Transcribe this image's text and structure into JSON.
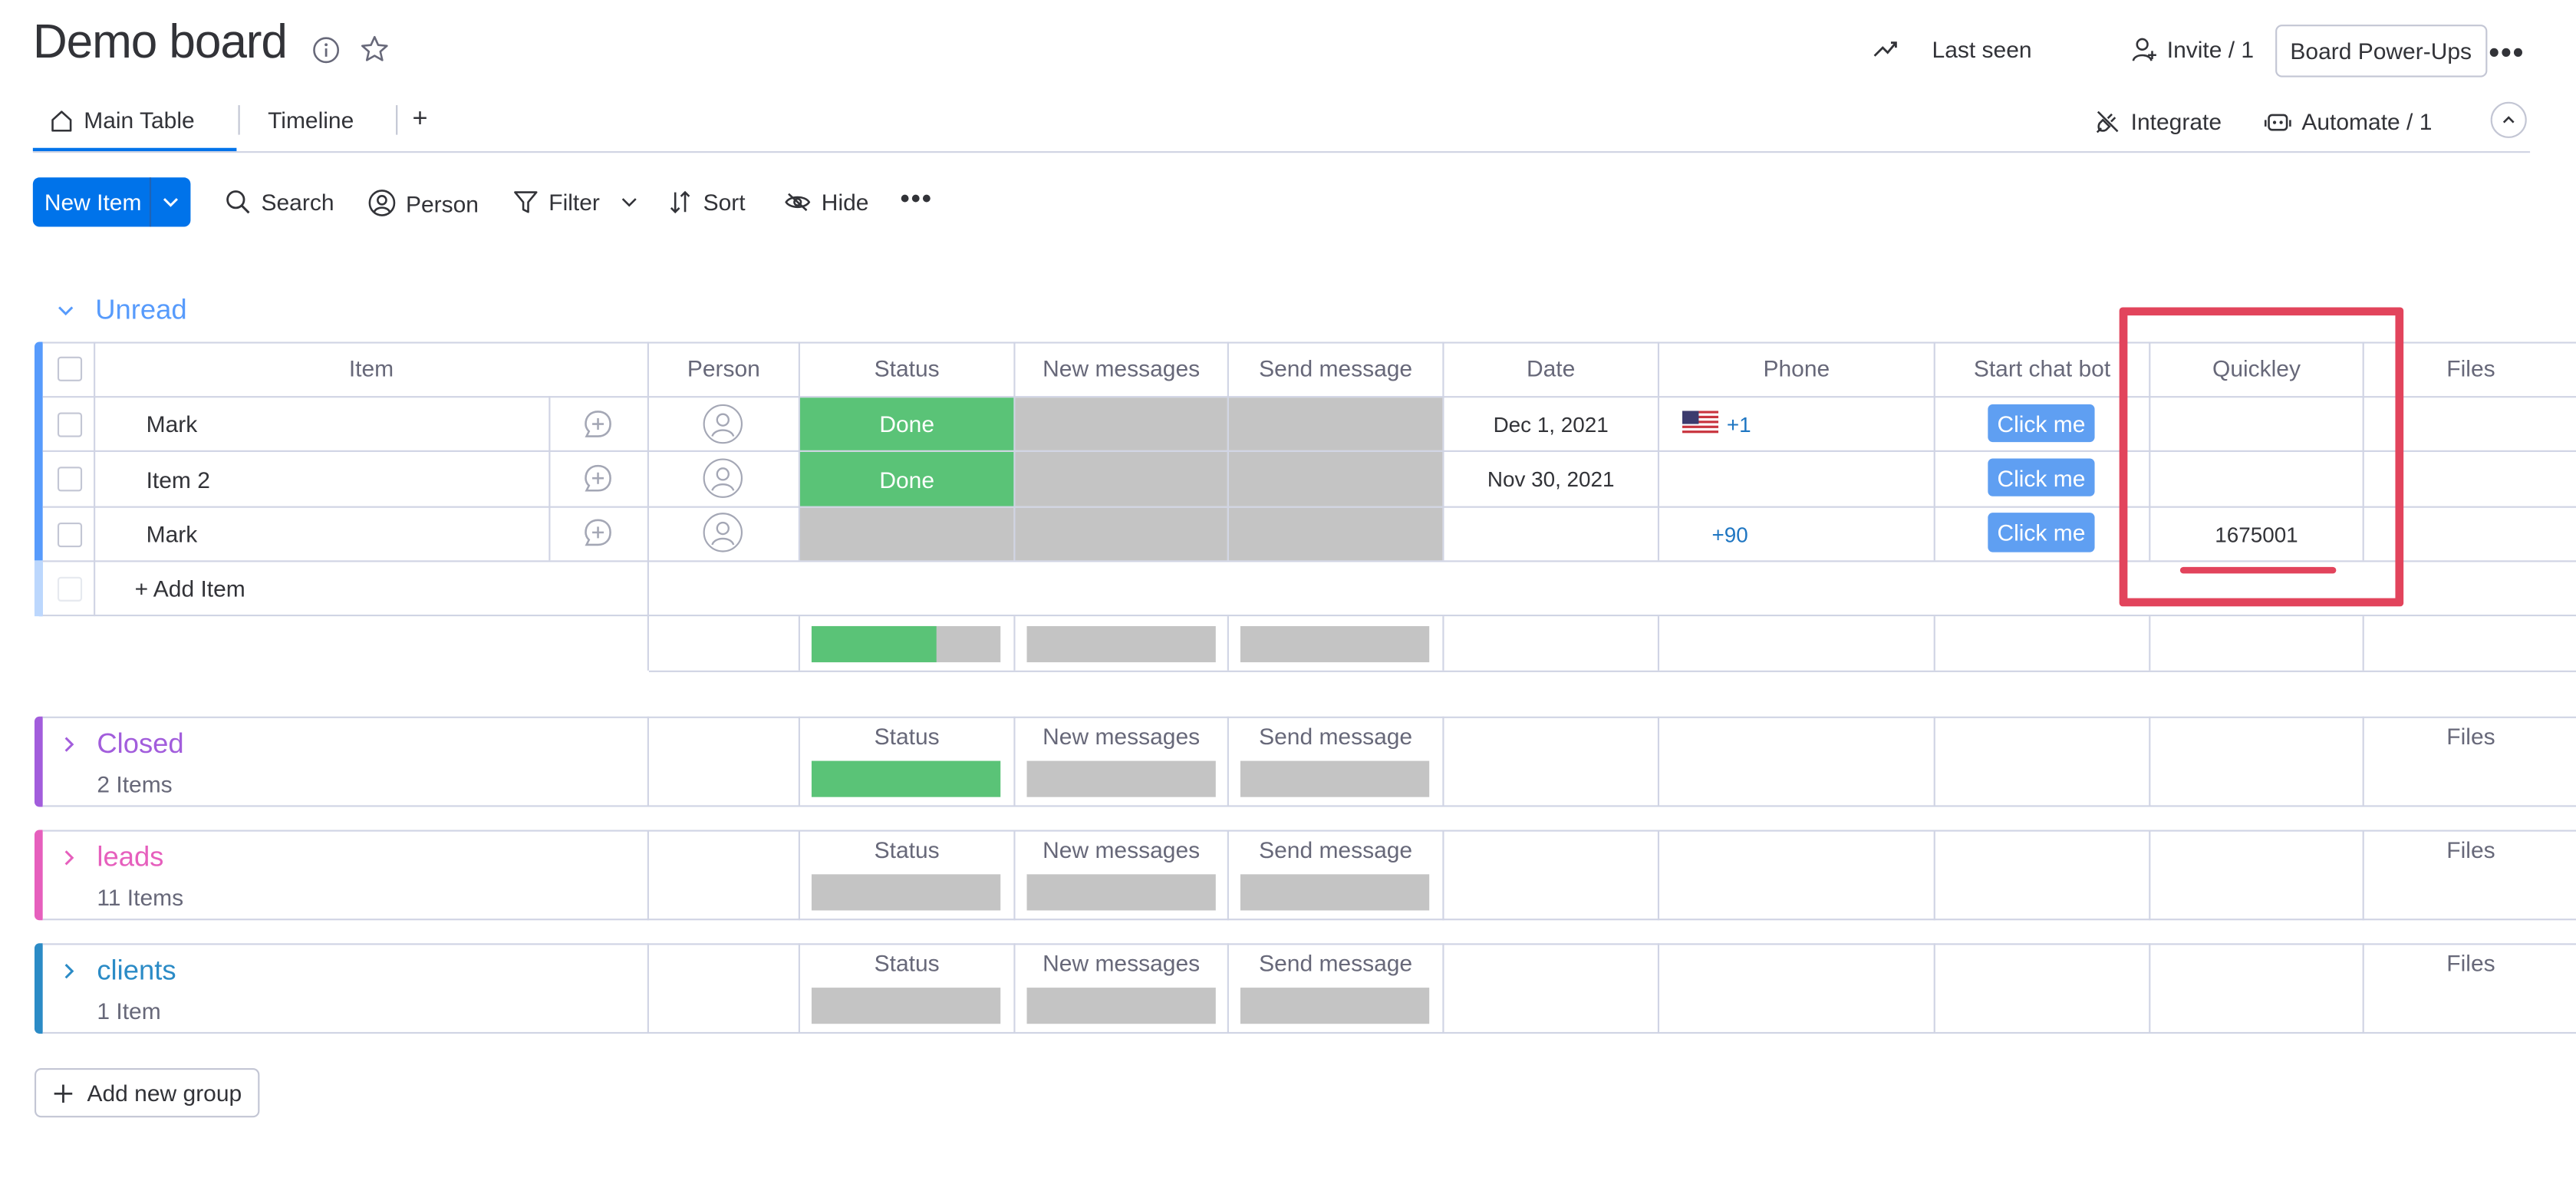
{
  "header": {
    "title": "Demo board",
    "last_seen": "Last seen",
    "invite": "Invite / 1",
    "power_ups": "Board Power-Ups"
  },
  "tabs": {
    "main_table": "Main Table",
    "timeline": "Timeline",
    "add": "+",
    "integrate": "Integrate",
    "automate": "Automate / 1"
  },
  "toolbar": {
    "new_item": "New Item",
    "search": "Search",
    "person": "Person",
    "filter": "Filter",
    "sort": "Sort",
    "hide": "Hide"
  },
  "columns": {
    "item": "Item",
    "person": "Person",
    "status": "Status",
    "new_messages": "New messages",
    "send_message": "Send message",
    "date": "Date",
    "phone": "Phone",
    "start_chat_bot": "Start chat bot",
    "quickley": "Quickley",
    "files": "Files"
  },
  "groups": {
    "unread": {
      "title": "Unread",
      "color": "#579bfc",
      "rows": [
        {
          "name": "Mark",
          "status": "Done",
          "date": "Dec 1, 2021",
          "phone": "+1",
          "chat": "Click me",
          "quickley": ""
        },
        {
          "name": "Item 2",
          "status": "Done",
          "date": "Nov 30, 2021",
          "phone": "",
          "chat": "Click me",
          "quickley": ""
        },
        {
          "name": "Mark",
          "status": "",
          "date": "",
          "phone": "+90",
          "chat": "Click me",
          "quickley": "1675001"
        }
      ],
      "add_item": "+ Add Item"
    },
    "closed": {
      "title": "Closed",
      "count": "2 Items",
      "color": "#a25ddc"
    },
    "leads": {
      "title": "leads",
      "count": "11 Items",
      "color": "#e65fbd"
    },
    "clients": {
      "title": "clients",
      "count": "1 Item",
      "color": "#2b8bc6"
    }
  },
  "add_group": "Add new group",
  "colors": {
    "primary": "#0073ea",
    "done": "#5ac377",
    "empty_status": "#c4c4c4",
    "chat_button": "#5f9ff2",
    "highlight": "#e2445c"
  },
  "summary": {
    "unread_status_done_fraction": 0.66
  }
}
